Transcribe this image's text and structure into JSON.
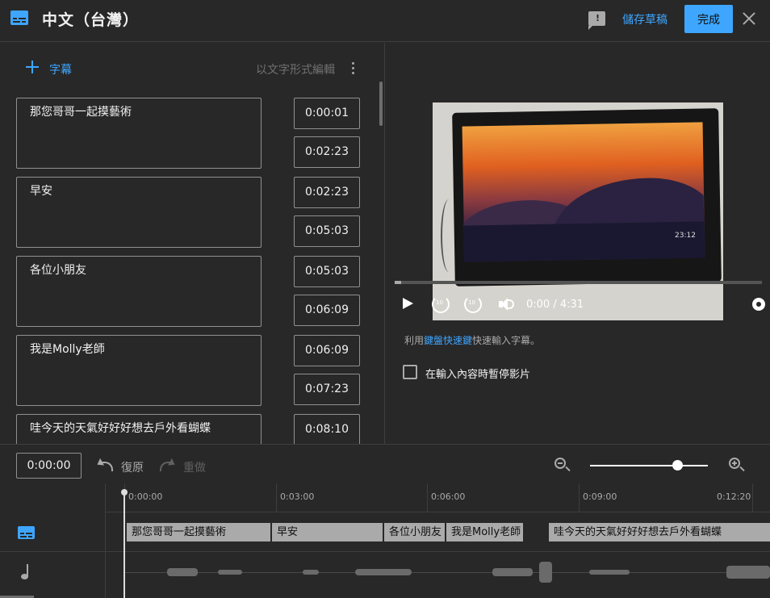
{
  "header": {
    "title": "中文（台灣）",
    "feedback_glyph": "!",
    "save_draft": "儲存草稿",
    "done": "完成"
  },
  "left_panel": {
    "add_label": "字幕",
    "edit_as_text": "以文字形式編輯",
    "cues": [
      {
        "text": "那您哥哥一起摸藝術",
        "start": "0:00:01",
        "end": "0:02:23"
      },
      {
        "text": "早安",
        "start": "0:02:23",
        "end": "0:05:03"
      },
      {
        "text": "各位小朋友",
        "start": "0:05:03",
        "end": "0:06:09"
      },
      {
        "text": "我是Molly老師",
        "start": "0:06:09",
        "end": "0:07:23"
      },
      {
        "text": "哇今天的天氣好好好想去戶外看蝴蝶",
        "start": "0:08:10",
        "end": ""
      }
    ]
  },
  "player": {
    "clock": "23:12",
    "rewind_label": "10",
    "forward_label": "10",
    "time": "0:00 / 4:31",
    "progress": 0.0
  },
  "hint": {
    "prefix": "利用",
    "link": "鍵盤快速鍵",
    "suffix": "快速輸入字幕。"
  },
  "pause_checkbox": {
    "label": "在輸入內容時暫停影片",
    "checked": false
  },
  "timeline": {
    "current_time": "0:00:00",
    "undo": "復原",
    "redo": "重做",
    "ticks": [
      "0:00:00",
      "0:03:00",
      "0:06:00",
      "0:09:00",
      "0:12:20"
    ],
    "segments": [
      "那您哥哥一起摸藝術",
      "早安",
      "各位小朋友",
      "我是Molly老師",
      "哇今天的天氣好好好想去戶外看蝴蝶"
    ]
  },
  "colors": {
    "accent": "#3ea6ff",
    "background": "#282828"
  }
}
